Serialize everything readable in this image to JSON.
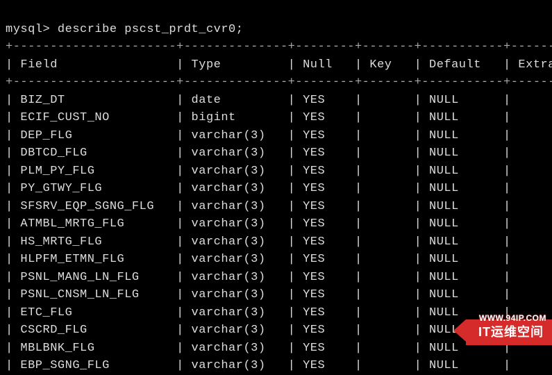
{
  "prompt": "mysql> describe pscst_prdt_cvr0;",
  "columns": [
    "Field",
    "Type",
    "Null",
    "Key",
    "Default",
    "Extra"
  ],
  "rows": [
    {
      "field": "BIZ_DT",
      "type": "date",
      "null": "YES",
      "key": "",
      "default": "NULL",
      "extra": ""
    },
    {
      "field": "ECIF_CUST_NO",
      "type": "bigint",
      "null": "YES",
      "key": "",
      "default": "NULL",
      "extra": ""
    },
    {
      "field": "DEP_FLG",
      "type": "varchar(3)",
      "null": "YES",
      "key": "",
      "default": "NULL",
      "extra": ""
    },
    {
      "field": "DBTCD_FLG",
      "type": "varchar(3)",
      "null": "YES",
      "key": "",
      "default": "NULL",
      "extra": ""
    },
    {
      "field": "PLM_PY_FLG",
      "type": "varchar(3)",
      "null": "YES",
      "key": "",
      "default": "NULL",
      "extra": ""
    },
    {
      "field": "PY_GTWY_FLG",
      "type": "varchar(3)",
      "null": "YES",
      "key": "",
      "default": "NULL",
      "extra": ""
    },
    {
      "field": "SFSRV_EQP_SGNG_FLG",
      "type": "varchar(3)",
      "null": "YES",
      "key": "",
      "default": "NULL",
      "extra": ""
    },
    {
      "field": "ATMBL_MRTG_FLG",
      "type": "varchar(3)",
      "null": "YES",
      "key": "",
      "default": "NULL",
      "extra": ""
    },
    {
      "field": "HS_MRTG_FLG",
      "type": "varchar(3)",
      "null": "YES",
      "key": "",
      "default": "NULL",
      "extra": ""
    },
    {
      "field": "HLPFM_ETMN_FLG",
      "type": "varchar(3)",
      "null": "YES",
      "key": "",
      "default": "NULL",
      "extra": ""
    },
    {
      "field": "PSNL_MANG_LN_FLG",
      "type": "varchar(3)",
      "null": "YES",
      "key": "",
      "default": "NULL",
      "extra": ""
    },
    {
      "field": "PSNL_CNSM_LN_FLG",
      "type": "varchar(3)",
      "null": "YES",
      "key": "",
      "default": "NULL",
      "extra": ""
    },
    {
      "field": "ETC_FLG",
      "type": "varchar(3)",
      "null": "YES",
      "key": "",
      "default": "NULL",
      "extra": ""
    },
    {
      "field": "CSCRD_FLG",
      "type": "varchar(3)",
      "null": "YES",
      "key": "",
      "default": "NULL",
      "extra": ""
    },
    {
      "field": "MBLBNK_FLG",
      "type": "varchar(3)",
      "null": "YES",
      "key": "",
      "default": "NULL",
      "extra": ""
    },
    {
      "field": "EBP_SGNG_FLG",
      "type": "varchar(3)",
      "null": "YES",
      "key": "",
      "default": "NULL",
      "extra": ""
    }
  ],
  "watermark": {
    "url": "WWW.94IP.COM",
    "text": "IT运维空间"
  },
  "colwidths": {
    "field": 20,
    "type": 12,
    "null": 6,
    "key": 5,
    "default": 9,
    "extra": 7
  }
}
